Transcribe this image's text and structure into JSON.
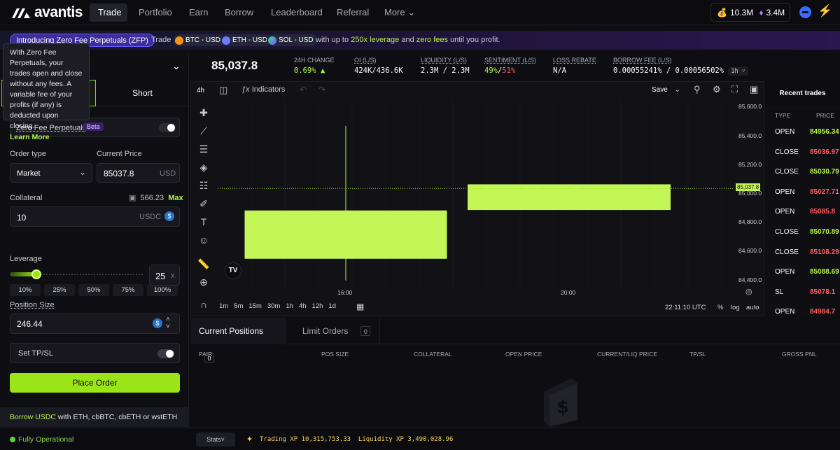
{
  "brand": {
    "name": "avantis"
  },
  "nav": {
    "items": [
      {
        "label": "Trade",
        "active": true
      },
      {
        "label": "Portfolio"
      },
      {
        "label": "Earn"
      },
      {
        "label": "Borrow"
      },
      {
        "label": "Leaderboard"
      },
      {
        "label": "Referral"
      },
      {
        "label": "More"
      }
    ]
  },
  "header": {
    "xp_a": "10.3M",
    "xp_b": "3.4M"
  },
  "banner": {
    "pill": "Introducing Zero Fee Perpetuals (ZFP)",
    "trade_label": "Trade",
    "pairs": [
      "BTC - USD",
      "ETH - USD",
      "SOL - USD"
    ],
    "text_prefix": "with up to",
    "leverage": "250x leverage",
    "text_and": "and",
    "fees": "zero fees",
    "text_suffix": "until you profit."
  },
  "tooltip": {
    "text": "With Zero Fee Perpetuals, your trades open and close without any fees. A variable fee of your profits (if any) is deducted upon closing.",
    "link": "Learn More"
  },
  "order": {
    "short_label": "Short",
    "zfp_label": "Zero Fee Perpetuals",
    "zfp_badge": "Beta",
    "order_type_label": "Order type",
    "order_type_value": "Market",
    "current_price_label": "Current Price",
    "current_price_value": "85037.8",
    "current_price_unit": "USD",
    "collateral_label": "Collateral",
    "balance": "566.23",
    "max_label": "Max",
    "collateral_value": "10",
    "collateral_unit": "USDC",
    "pct_buttons": [
      "10%",
      "25%",
      "50%",
      "75%",
      "100%"
    ],
    "leverage_label": "Leverage",
    "leverage_value": "25",
    "leverage_suffix": "x",
    "leverage_fraction": 0.2,
    "position_size_label": "Position Size",
    "position_size_value": "246.44",
    "tpsl_label": "Set TP/SL",
    "place_order_label": "Place Order"
  },
  "borrow_banner": {
    "highlight": "Borrow USDC",
    "text": "with ETH, cbBTC, cbETH or wstETH"
  },
  "ticker": {
    "price": "85,037.8",
    "stats": [
      {
        "title": "24H CHANGE",
        "value": "0.69%"
      },
      {
        "title": "OI (L/S)",
        "value": "424K/436.6K"
      },
      {
        "title": "LIQUIDITY (L/S)",
        "value": "2.3M / 2.3M"
      },
      {
        "title": "SENTIMENT (L/S)",
        "value_long": "49%",
        "value_sep": "/",
        "value_short": "51%"
      },
      {
        "title": "LOSS REBATE",
        "value": "N/A"
      },
      {
        "title": "BORROW FEE (L/S)",
        "value": "0.00055241% / 0.00056502%",
        "period": "1h"
      }
    ]
  },
  "chart": {
    "interval": "4h",
    "indicators_label": "Indicators",
    "save_label": "Save",
    "y_labels": [
      "85,600.0",
      "85,400.0",
      "85,200.0",
      "85,000.0",
      "84,800.0",
      "84,600.0",
      "84,400.0"
    ],
    "last_price_label": "85,037.8",
    "x_labels": [
      "16:00",
      "20:00"
    ],
    "timeframes": [
      "1m",
      "5m",
      "15m",
      "30m",
      "1h",
      "4h",
      "12h",
      "1d"
    ],
    "clock": "22:11:10 UTC",
    "pct_label": "%",
    "log_label": "log",
    "auto_label": "auto",
    "colors": {
      "candle": "#c4f557",
      "wick": "#b7f34d"
    }
  },
  "chart_data": {
    "type": "candlestick",
    "x": [
      "16:00",
      "20:00"
    ],
    "candles": [
      {
        "time": "16:00",
        "open": 84550,
        "close": 84885,
        "high": 85470,
        "low": 84400
      },
      {
        "time": "20:00",
        "open": 84888,
        "close": 85066,
        "high": 85066,
        "low": 84888
      }
    ],
    "ylim": [
      84350,
      85650
    ],
    "last_price": 85037.8
  },
  "recent_trades": {
    "title": "Recent trades",
    "col_type": "TYPE",
    "col_price": "PRICE",
    "rows": [
      {
        "type": "OPEN",
        "price": "84956.34",
        "color": "#b7f34d"
      },
      {
        "type": "CLOSE",
        "price": "85036.97",
        "color": "#ff5c5c"
      },
      {
        "type": "CLOSE",
        "price": "85030.79",
        "color": "#b7f34d"
      },
      {
        "type": "OPEN",
        "price": "85027.71",
        "color": "#ff5c5c"
      },
      {
        "type": "OPEN",
        "price": "85085.8",
        "color": "#ff5c5c"
      },
      {
        "type": "CLOSE",
        "price": "85070.89",
        "color": "#b7f34d"
      },
      {
        "type": "CLOSE",
        "price": "85108.29",
        "color": "#ff5c5c"
      },
      {
        "type": "OPEN",
        "price": "85088.69",
        "color": "#b7f34d"
      },
      {
        "type": "SL",
        "price": "85078.1",
        "color": "#ff5c5c"
      },
      {
        "type": "OPEN",
        "price": "84984.7",
        "color": "#ff5c5c"
      }
    ]
  },
  "positions": {
    "tab_current": "Current Positions",
    "tab_current_count": "0",
    "tab_limit": "Limit Orders",
    "tab_limit_count": "0",
    "columns": [
      "PAIR",
      "POS SIZE",
      "COLLATERAL",
      "OPEN PRICE",
      "CURRENT/LIQ PRICE",
      "TP/SL",
      "GROSS PNL"
    ]
  },
  "footer": {
    "status": "Fully Operational",
    "stats_label": "Stats",
    "trading_xp_label": "Trading XP",
    "trading_xp_value": "10,315,753.33",
    "liquidity_xp_label": "Liquidity XP",
    "liquidity_xp_value": "3,490,028.96"
  }
}
